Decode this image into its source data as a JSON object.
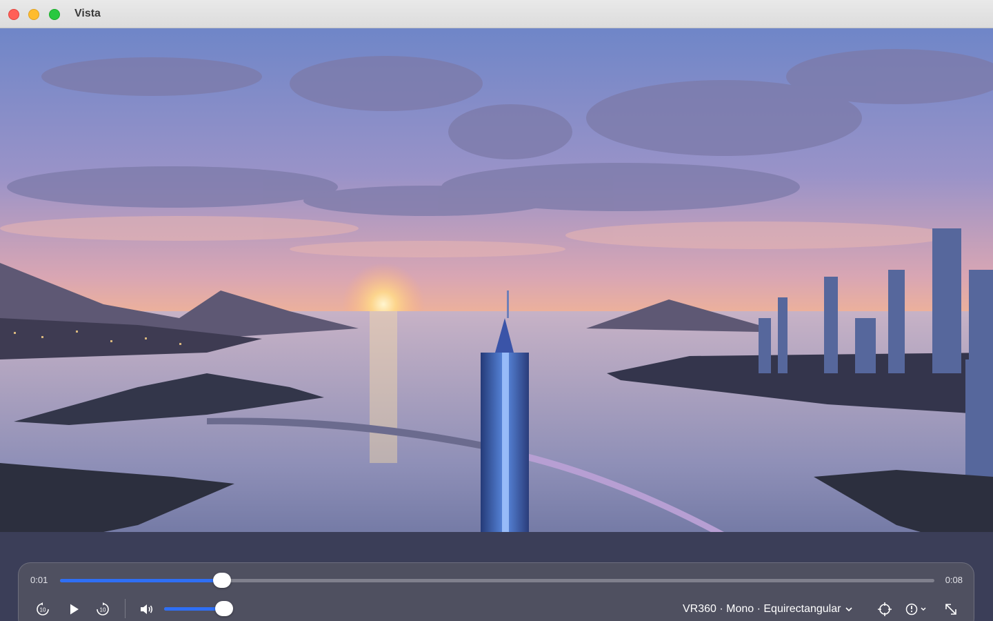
{
  "window": {
    "title": "Vista"
  },
  "player": {
    "current_time": "0:01",
    "duration": "0:08",
    "progress_fraction": 0.185,
    "volume_fraction": 0.95,
    "projection_label": "VR360 · Mono · Equirectangular"
  },
  "icons": {
    "skip_back": "skip-back-10-icon",
    "play": "play-icon",
    "skip_forward": "skip-forward-10-icon",
    "volume": "speaker-volume-icon",
    "projection_menu": "chevron-down-icon",
    "recenter": "crosshair-icon",
    "view_options": "compass-menu-icon",
    "fullscreen": "expand-arrows-icon"
  },
  "colors": {
    "accent": "#2f6ff5",
    "close": "#ff5f57",
    "minimize": "#febc2e",
    "maximize": "#28c840"
  }
}
